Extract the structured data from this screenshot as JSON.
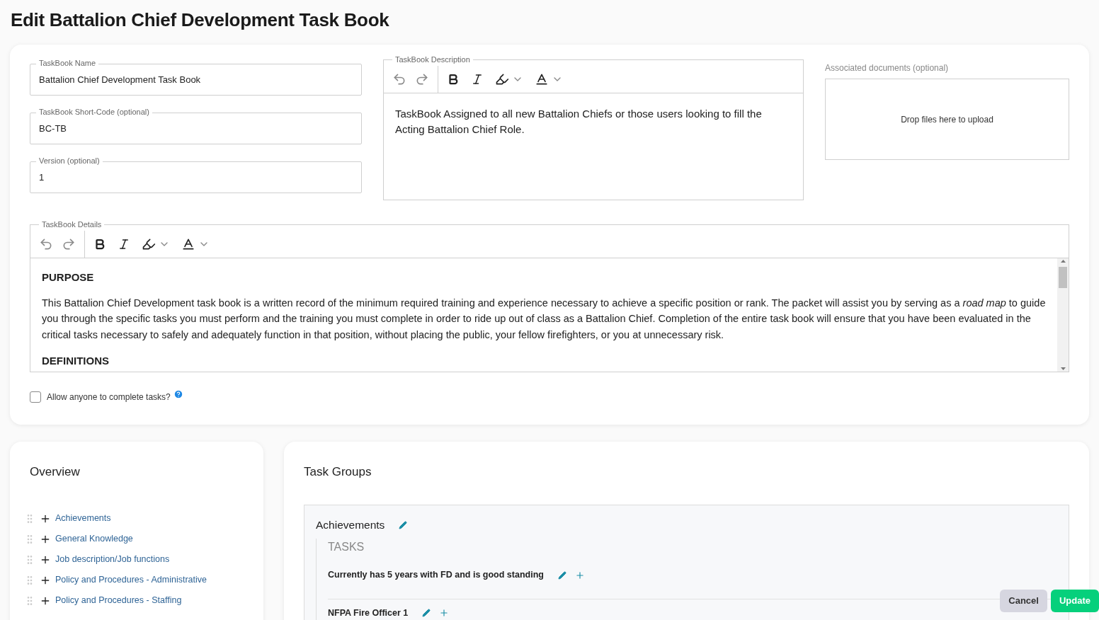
{
  "page_title": "Edit Battalion Chief Development Task Book",
  "fields": [
    {
      "label": "TaskBook Name",
      "value": "Battalion Chief Development Task Book"
    },
    {
      "label": "TaskBook Short-Code (optional)",
      "value": "BC-TB"
    },
    {
      "label": "Version (optional)",
      "value": "1"
    }
  ],
  "description": {
    "label": "TaskBook Description",
    "text": "TaskBook Assigned to all new Battalion Chiefs or those users looking to fill the Acting Battalion Chief Role."
  },
  "documents": {
    "label": "Associated documents (optional)",
    "dropzone": "Drop files here to upload"
  },
  "details": {
    "label": "TaskBook Details",
    "blocks": [
      {
        "kind": "heading",
        "text": "PURPOSE"
      },
      {
        "kind": "paragraph",
        "text": "This Battalion Chief Development task book is a written record of the minimum required training and experience necessary to achieve a specific position or rank. The packet will assist you by serving as a *road map* to guide you through the specific tasks you must perform and the training you must complete in order to ride up out of class as a Battalion Chief. Completion of the entire task book will ensure that you have been evaluated in the critical tasks necessary to safely and adequately function in that position, without placing the public, your fellow firefighters, or you at unnecessary risk."
      },
      {
        "kind": "heading",
        "text": "DEFINITIONS"
      }
    ]
  },
  "allow_anyone": {
    "label": "Allow anyone to complete tasks?",
    "checked": false
  },
  "overview": {
    "title": "Overview",
    "items": [
      "Achievements",
      "General Knowledge",
      "Job description/Job functions",
      "Policy and Procedures - Administrative",
      "Policy and Procedures - Staffing"
    ]
  },
  "task_groups": {
    "title": "Task Groups",
    "groups": [
      {
        "name": "Achievements",
        "section": "TASKS",
        "tasks": [
          "Currently has 5 years with FD and is good standing",
          "NFPA Fire Officer 1"
        ]
      }
    ]
  },
  "buttons": [
    {
      "label": "Cancel",
      "kind": "secondary"
    },
    {
      "label": "Update",
      "kind": "primary"
    }
  ]
}
